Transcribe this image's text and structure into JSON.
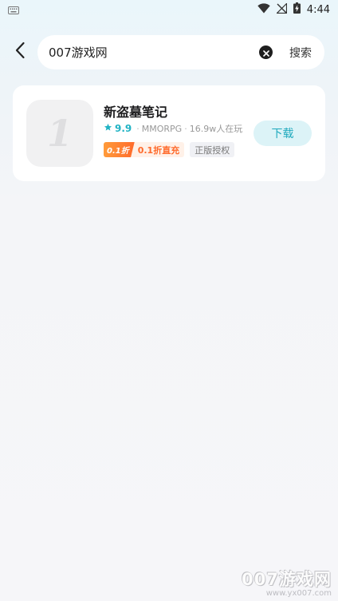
{
  "status_bar": {
    "time": "4:44",
    "icons": [
      "keyboard-icon",
      "wifi-icon",
      "no-signal-icon",
      "battery-charging-icon"
    ]
  },
  "search": {
    "value": "007游戏网",
    "search_button": "搜索"
  },
  "results": [
    {
      "name": "新盗墓笔记",
      "rating": "9.9",
      "genre": "MMORPG",
      "players": "16.9w人在玩",
      "discount_badge": "0.1折",
      "discount_text": "0.1折直充",
      "license_tag": "正版授权",
      "action": "下载",
      "icon_glyph": "1"
    }
  ],
  "watermark": {
    "title": "007游戏网",
    "url": "www.yx007.com"
  },
  "colors": {
    "accent": "#21b3c4",
    "download_bg": "#dcf3f7",
    "discount": "#ff6a2b"
  }
}
